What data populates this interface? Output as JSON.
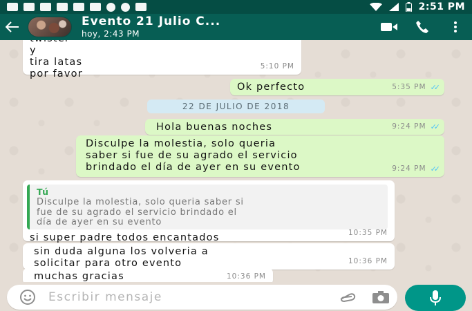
{
  "status": {
    "time": "2:51 PM"
  },
  "header": {
    "title": "Evento 21 Julio C...",
    "subtitle": "hoy, 2:43 PM"
  },
  "messages": [
    {
      "side": "in",
      "lines": [
        "twister",
        "y",
        "tira latas",
        "por favor"
      ],
      "time": "5:10 PM"
    },
    {
      "side": "out",
      "text": "Ok perfecto",
      "time": "5:35 PM",
      "read": true
    },
    {
      "side": "out",
      "text": "Hola buenas noches",
      "time": "9:24 PM",
      "read": true
    },
    {
      "side": "out",
      "lines": [
        "Disculpe la molestia, solo queria",
        "saber si fue de su agrado el servicio",
        "brindado el día de ayer en su evento"
      ],
      "time": "9:24 PM",
      "read": true
    },
    {
      "side": "in",
      "quote_author": "Tú",
      "quote_lines": [
        "Disculpe la molestia, solo queria saber si",
        "fue de su agrado el servicio brindado el",
        "día de ayer en su evento"
      ],
      "text": "si super padre todos encantados",
      "time": "10:35 PM"
    },
    {
      "side": "in",
      "lines": [
        "sin duda alguna los volveria a",
        "solicitar para otro evento"
      ],
      "time": "10:36 PM"
    },
    {
      "side": "in",
      "text": "muchas gracias",
      "time": "10:36 PM"
    }
  ],
  "date_divider": "22 DE JULIO DE 2018",
  "composer": {
    "placeholder": "Escribir mensaje"
  },
  "colors": {
    "header": "#075e54",
    "outgoing": "#dcf8c6",
    "incoming": "#ffffff",
    "mic": "#009688",
    "read_ticks": "#4fc3f7"
  }
}
